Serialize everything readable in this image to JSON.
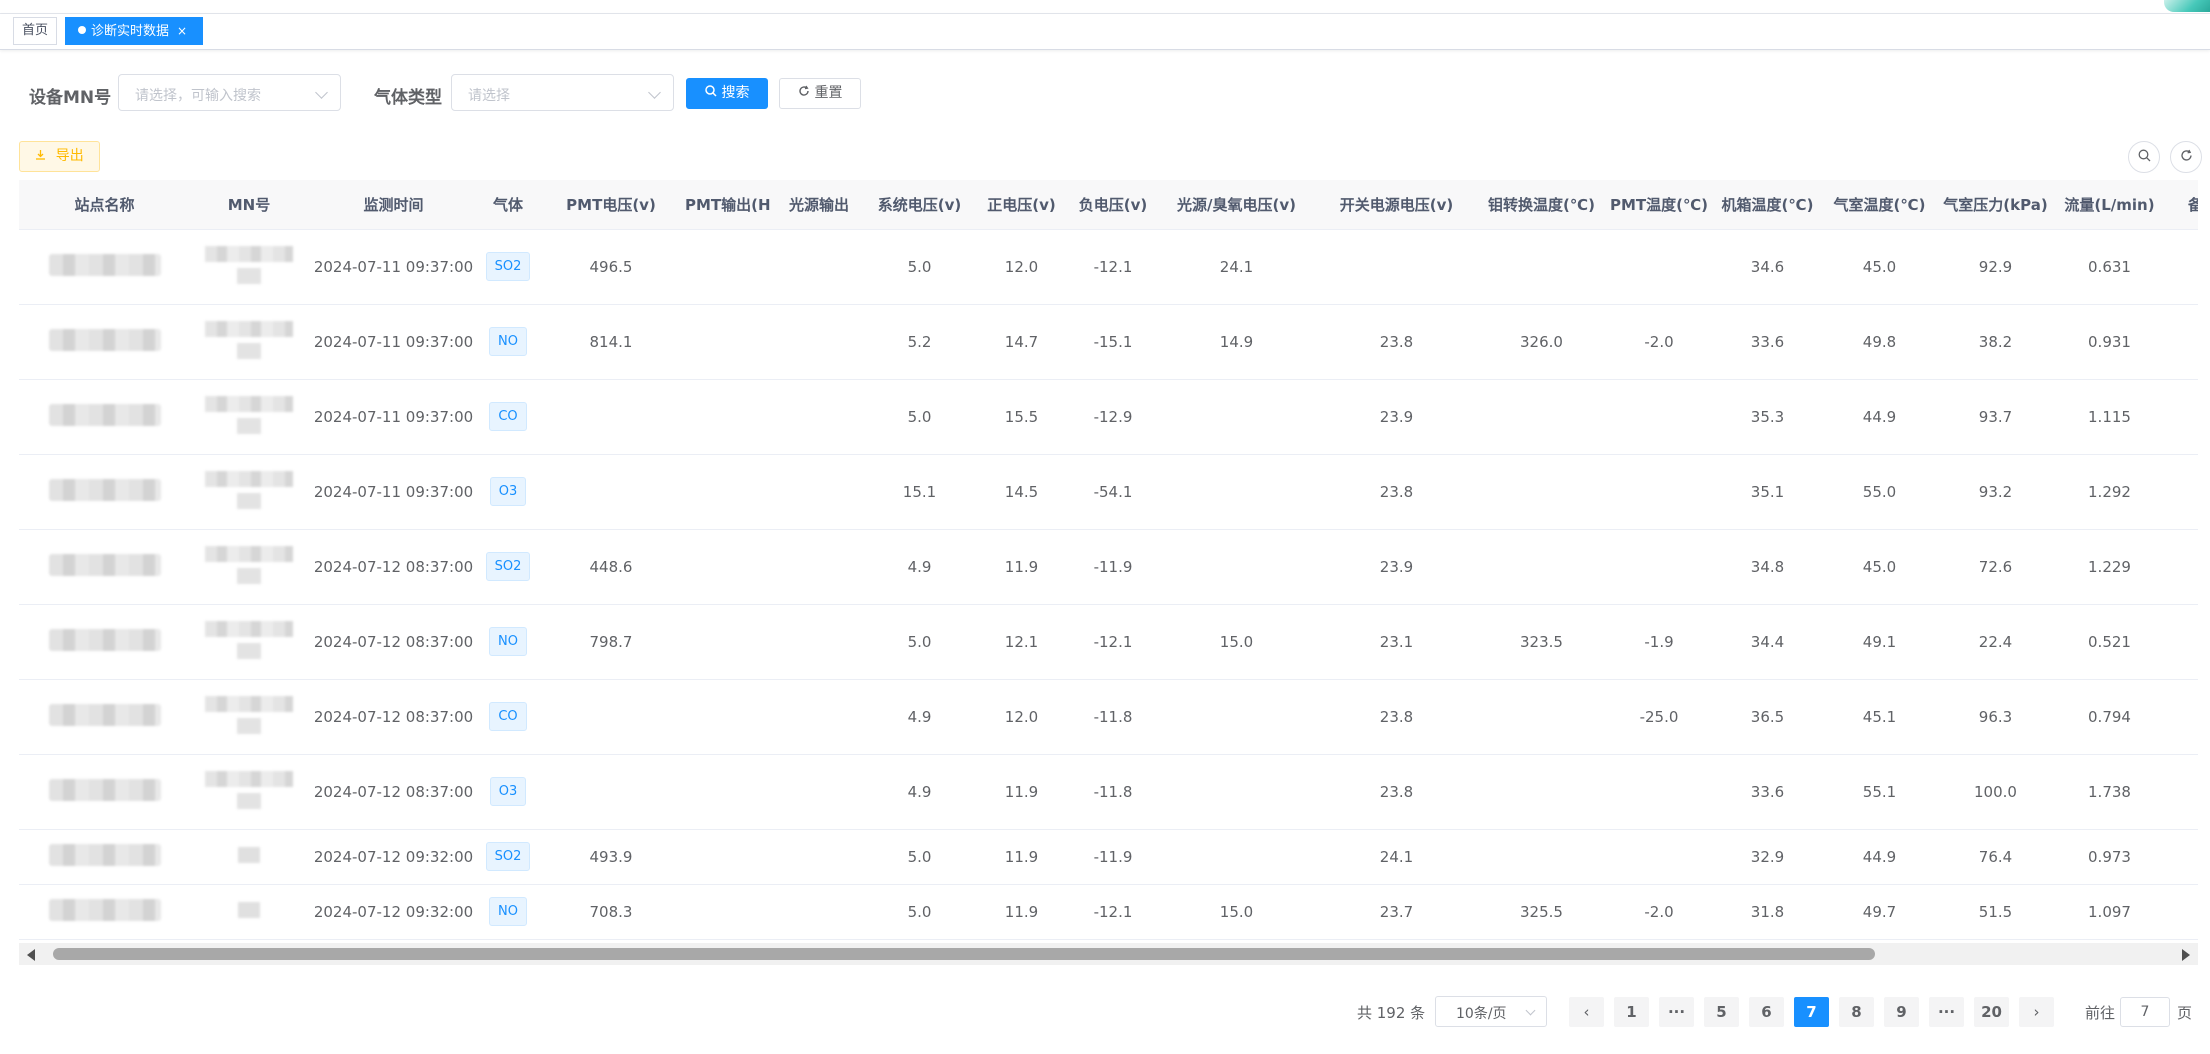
{
  "tags": {
    "home": "首页",
    "active": "诊断实时数据",
    "close": "×"
  },
  "search": {
    "mn_label": "设备MN号",
    "mn_placeholder": "请选择，可输入搜索",
    "gas_label": "气体类型",
    "gas_placeholder": "请选择",
    "search_button": "搜索",
    "reset_button": "重置"
  },
  "toolbar": {
    "export_button": "导出"
  },
  "table": {
    "columns": [
      "站点名称",
      "MN号",
      "监测时间",
      "气体",
      "PMT电压(v)",
      "PMT输出(Hz)",
      "光源输出",
      "系统电压(v)",
      "正电压(v)",
      "负电压(v)",
      "光源/臭氧电压(v)",
      "开关电源电压(v)",
      "钼转换温度(℃)",
      "PMT温度(℃)",
      "机箱温度(℃)",
      "气室温度(℃)",
      "气室压力(kPa)",
      "流量(L/min)",
      "备"
    ],
    "rows": [
      {
        "time": "2024-07-11 09:37:00",
        "gas": "SO2",
        "pmt_v": "496.5",
        "pmt_hz": "",
        "light": "",
        "sys_v": "5.0",
        "pos_v": "12.0",
        "neg_v": "-12.1",
        "light_o3_v": "24.1",
        "switch_v": "",
        "mo_temp": "",
        "pmt_temp": "",
        "box_temp": "34.6",
        "cell_temp": "45.0",
        "cell_press": "92.9",
        "flow": "0.631"
      },
      {
        "time": "2024-07-11 09:37:00",
        "gas": "NO",
        "pmt_v": "814.1",
        "pmt_hz": "",
        "light": "",
        "sys_v": "5.2",
        "pos_v": "14.7",
        "neg_v": "-15.1",
        "light_o3_v": "14.9",
        "switch_v": "23.8",
        "mo_temp": "326.0",
        "pmt_temp": "-2.0",
        "box_temp": "33.6",
        "cell_temp": "49.8",
        "cell_press": "38.2",
        "flow": "0.931"
      },
      {
        "time": "2024-07-11 09:37:00",
        "gas": "CO",
        "pmt_v": "",
        "pmt_hz": "",
        "light": "",
        "sys_v": "5.0",
        "pos_v": "15.5",
        "neg_v": "-12.9",
        "light_o3_v": "",
        "switch_v": "23.9",
        "mo_temp": "",
        "pmt_temp": "",
        "box_temp": "35.3",
        "cell_temp": "44.9",
        "cell_press": "93.7",
        "flow": "1.115"
      },
      {
        "time": "2024-07-11 09:37:00",
        "gas": "O3",
        "pmt_v": "",
        "pmt_hz": "",
        "light": "",
        "sys_v": "15.1",
        "pos_v": "14.5",
        "neg_v": "-54.1",
        "light_o3_v": "",
        "switch_v": "23.8",
        "mo_temp": "",
        "pmt_temp": "",
        "box_temp": "35.1",
        "cell_temp": "55.0",
        "cell_press": "93.2",
        "flow": "1.292"
      },
      {
        "time": "2024-07-12 08:37:00",
        "gas": "SO2",
        "pmt_v": "448.6",
        "pmt_hz": "",
        "light": "",
        "sys_v": "4.9",
        "pos_v": "11.9",
        "neg_v": "-11.9",
        "light_o3_v": "",
        "switch_v": "23.9",
        "mo_temp": "",
        "pmt_temp": "",
        "box_temp": "34.8",
        "cell_temp": "45.0",
        "cell_press": "72.6",
        "flow": "1.229"
      },
      {
        "time": "2024-07-12 08:37:00",
        "gas": "NO",
        "pmt_v": "798.7",
        "pmt_hz": "",
        "light": "",
        "sys_v": "5.0",
        "pos_v": "12.1",
        "neg_v": "-12.1",
        "light_o3_v": "15.0",
        "switch_v": "23.1",
        "mo_temp": "323.5",
        "pmt_temp": "-1.9",
        "box_temp": "34.4",
        "cell_temp": "49.1",
        "cell_press": "22.4",
        "flow": "0.521"
      },
      {
        "time": "2024-07-12 08:37:00",
        "gas": "CO",
        "pmt_v": "",
        "pmt_hz": "",
        "light": "",
        "sys_v": "4.9",
        "pos_v": "12.0",
        "neg_v": "-11.8",
        "light_o3_v": "",
        "switch_v": "23.8",
        "mo_temp": "",
        "pmt_temp": "-25.0",
        "box_temp": "36.5",
        "cell_temp": "45.1",
        "cell_press": "96.3",
        "flow": "0.794"
      },
      {
        "time": "2024-07-12 08:37:00",
        "gas": "O3",
        "pmt_v": "",
        "pmt_hz": "",
        "light": "",
        "sys_v": "4.9",
        "pos_v": "11.9",
        "neg_v": "-11.8",
        "light_o3_v": "",
        "switch_v": "23.8",
        "mo_temp": "",
        "pmt_temp": "",
        "box_temp": "33.6",
        "cell_temp": "55.1",
        "cell_press": "100.0",
        "flow": "1.738"
      },
      {
        "time": "2024-07-12 09:32:00",
        "gas": "SO2",
        "pmt_v": "493.9",
        "pmt_hz": "",
        "light": "",
        "sys_v": "5.0",
        "pos_v": "11.9",
        "neg_v": "-11.9",
        "light_o3_v": "",
        "switch_v": "24.1",
        "mo_temp": "",
        "pmt_temp": "",
        "box_temp": "32.9",
        "cell_temp": "44.9",
        "cell_press": "76.4",
        "flow": "0.973"
      },
      {
        "time": "2024-07-12 09:32:00",
        "gas": "NO",
        "pmt_v": "708.3",
        "pmt_hz": "",
        "light": "",
        "sys_v": "5.0",
        "pos_v": "11.9",
        "neg_v": "-12.1",
        "light_o3_v": "15.0",
        "switch_v": "23.7",
        "mo_temp": "325.5",
        "pmt_temp": "-2.0",
        "box_temp": "31.8",
        "cell_temp": "49.7",
        "cell_press": "51.5",
        "flow": "1.097"
      }
    ]
  },
  "pagination": {
    "total": "共 192 条",
    "page_size": "10条/页",
    "pages": [
      "1",
      "···",
      "5",
      "6",
      "7",
      "8",
      "9",
      "···",
      "20"
    ],
    "current": "7",
    "prev": "‹",
    "next": "›",
    "goto_prefix": "前往",
    "goto_value": "7",
    "goto_suffix": "页"
  },
  "colors": {
    "primary": "#1890ff",
    "warning": "#ffba00",
    "header_bg": "#f8f8f9"
  },
  "icons": {
    "search": "search-icon",
    "reset": "refresh-icon",
    "export": "download-icon"
  }
}
